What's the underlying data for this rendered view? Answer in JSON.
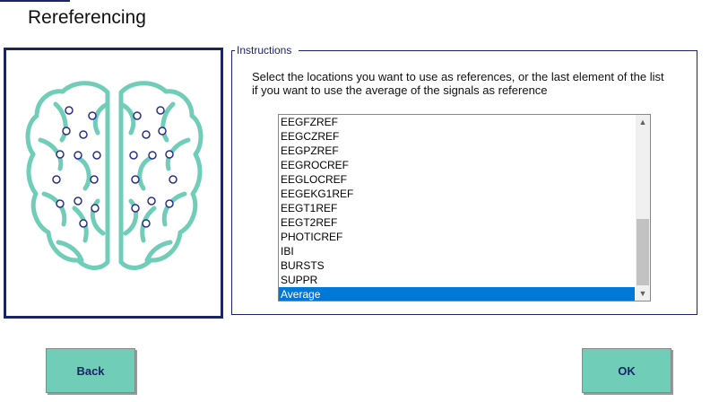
{
  "dialog": {
    "title": "Rereferencing"
  },
  "image": {
    "icon": "brain-electrodes-icon",
    "brain_color": "#6fcdb8",
    "electrode_color": "#2a2f8c"
  },
  "instructions": {
    "group_label": "Instructions",
    "text": "Select the locations you want to use as references, or the last element of the list if you want to use the average of the signals as reference"
  },
  "reference_list": {
    "items": [
      "EEGFZREF",
      "EEGCZREF",
      "EEGPZREF",
      "EEGROCREF",
      "EEGLOCREF",
      "EEGEKG1REF",
      "EEGT1REF",
      "EEGT2REF",
      "PHOTICREF",
      "IBI",
      "BURSTS",
      "SUPPR",
      "Average"
    ],
    "selected": "Average"
  },
  "buttons": {
    "back": "Back",
    "ok": "OK"
  },
  "colors": {
    "accent": "#1b2566",
    "button": "#6fcdb8",
    "selection": "#0078d7"
  }
}
